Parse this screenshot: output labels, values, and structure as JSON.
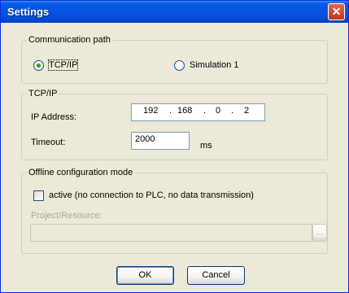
{
  "window": {
    "title": "Settings",
    "close_symbol": "✕"
  },
  "comm_path": {
    "legend": "Communication path",
    "options": [
      {
        "label": "TCP/IP",
        "checked": true
      },
      {
        "label": "Simulation 1",
        "checked": false
      }
    ]
  },
  "tcpip": {
    "legend": "TCP/IP",
    "ip_label": "IP Address:",
    "ip_octets": [
      "192",
      "168",
      "0",
      "2"
    ],
    "ip_dot": ".",
    "timeout_label": "Timeout:",
    "timeout_value": "2000",
    "timeout_unit": "ms"
  },
  "offline": {
    "legend": "Offline configuration mode",
    "active_label": "active (no connection to PLC, no data transmission)",
    "active_checked": false,
    "project_label": "Project/Resource:",
    "project_value": "",
    "browse_label": "..."
  },
  "buttons": {
    "ok": "OK",
    "cancel": "Cancel"
  }
}
